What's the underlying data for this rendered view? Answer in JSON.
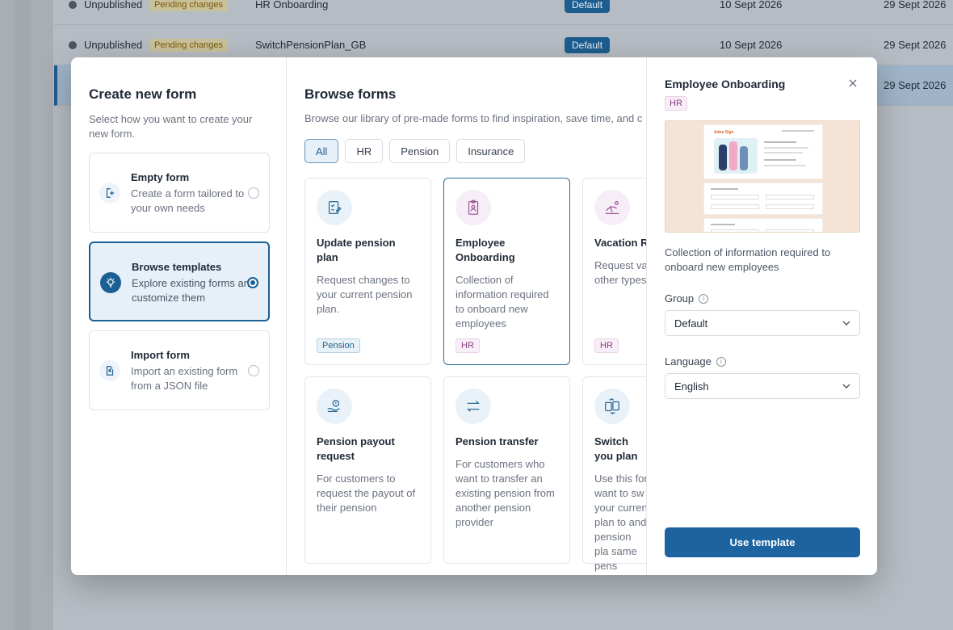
{
  "background": {
    "rows": [
      {
        "status": "Unpublished",
        "pending": "Pending changes",
        "name": "HR Onboarding",
        "group": "Default",
        "date1": "10 Sept 2026",
        "date2": "29 Sept 2026"
      },
      {
        "status": "Unpublished",
        "pending": "Pending changes",
        "name": "SwitchPensionPlan_GB",
        "group": "Default",
        "date1": "10 Sept 2026",
        "date2": "29 Sept 2026"
      },
      {
        "date2": "29 Sept 2026"
      }
    ]
  },
  "left": {
    "title": "Create new form",
    "subtitle": "Select how you want to create your new form.",
    "options": [
      {
        "title": "Empty form",
        "desc": "Create a form tailored to your own needs",
        "icon": "add-page-icon"
      },
      {
        "title": "Browse templates",
        "desc": "Explore existing forms and customize them",
        "icon": "lightbulb-icon"
      },
      {
        "title": "Import form",
        "desc": "Import an existing form from a JSON file",
        "icon": "import-icon"
      }
    ]
  },
  "middle": {
    "title": "Browse forms",
    "subtitle": "Browse our library of pre-made forms to find inspiration, save time, and c",
    "filters": [
      "All",
      "HR",
      "Pension",
      "Insurance"
    ],
    "cards": [
      {
        "title": "Update pension plan",
        "desc": "Request changes to your current pension plan.",
        "tag": "Pension"
      },
      {
        "title": "Employee Onboarding",
        "desc": "Collection of information required to onboard new employees",
        "tag": "HR"
      },
      {
        "title": "Vacation R",
        "desc": "Request va other types",
        "tag": "HR"
      },
      {
        "title": "Pension payout request",
        "desc": "For customers to request the payout of their pension"
      },
      {
        "title": "Pension transfer",
        "desc": "For customers who want to transfer an existing pension from another pension provider"
      },
      {
        "title": "Switch you plan",
        "desc": "Use this for want to sw your curren plan to and pension pla same pens"
      }
    ]
  },
  "right": {
    "title": "Employee Onboarding",
    "tag": "HR",
    "desc": "Collection of information required to onboard new employees",
    "group_label": "Group",
    "group_value": "Default",
    "language_label": "Language",
    "language_value": "English",
    "button": "Use template",
    "preview_logo": "Adea Sign"
  },
  "colors": {
    "primary": "#1c63a0",
    "pending": "#7a5b06",
    "hr_tag": "#8a3f86",
    "pension_tag": "#2a5f85"
  }
}
